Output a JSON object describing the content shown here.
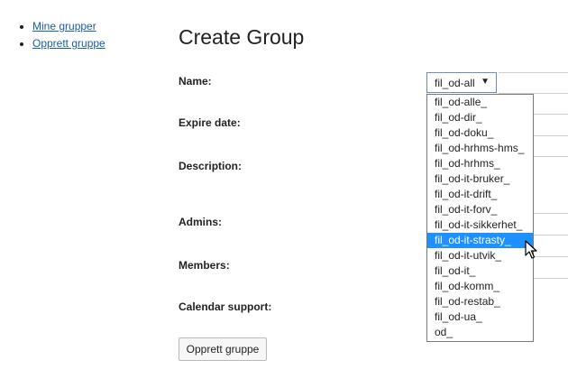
{
  "nav": {
    "items": [
      {
        "label": "Mine grupper"
      },
      {
        "label": "Opprett gruppe"
      }
    ]
  },
  "page_title": "Create Group",
  "form": {
    "name_label": "Name:",
    "expire_label": "Expire date:",
    "description_label": "Description:",
    "admins_label": "Admins:",
    "members_label": "Members:",
    "calendar_label": "Calendar support:",
    "submit_label": "Opprett gruppe"
  },
  "select": {
    "value": "fil_od-all",
    "arrow": "▼",
    "highlighted_option": "fil_od-it-strasty_",
    "options": [
      "fil_od-alle_",
      "fil_od-dir_",
      "fil_od-doku_",
      "fil_od-hrhms-hms_",
      "fil_od-hrhms_",
      "fil_od-it-bruker_",
      "fil_od-it-drift_",
      "fil_od-it-forv_",
      "fil_od-it-sikkerhet_",
      "fil_od-it-strasty_",
      "fil_od-it-utvik_",
      "fil_od-it_",
      "fil_od-komm_",
      "fil_od-restab_",
      "fil_od-ua_",
      "od_"
    ]
  },
  "colors": {
    "link": "#1a5ea8",
    "highlight": "#1e90ff"
  },
  "icons": {
    "cursor": "mouse-pointer-icon"
  }
}
